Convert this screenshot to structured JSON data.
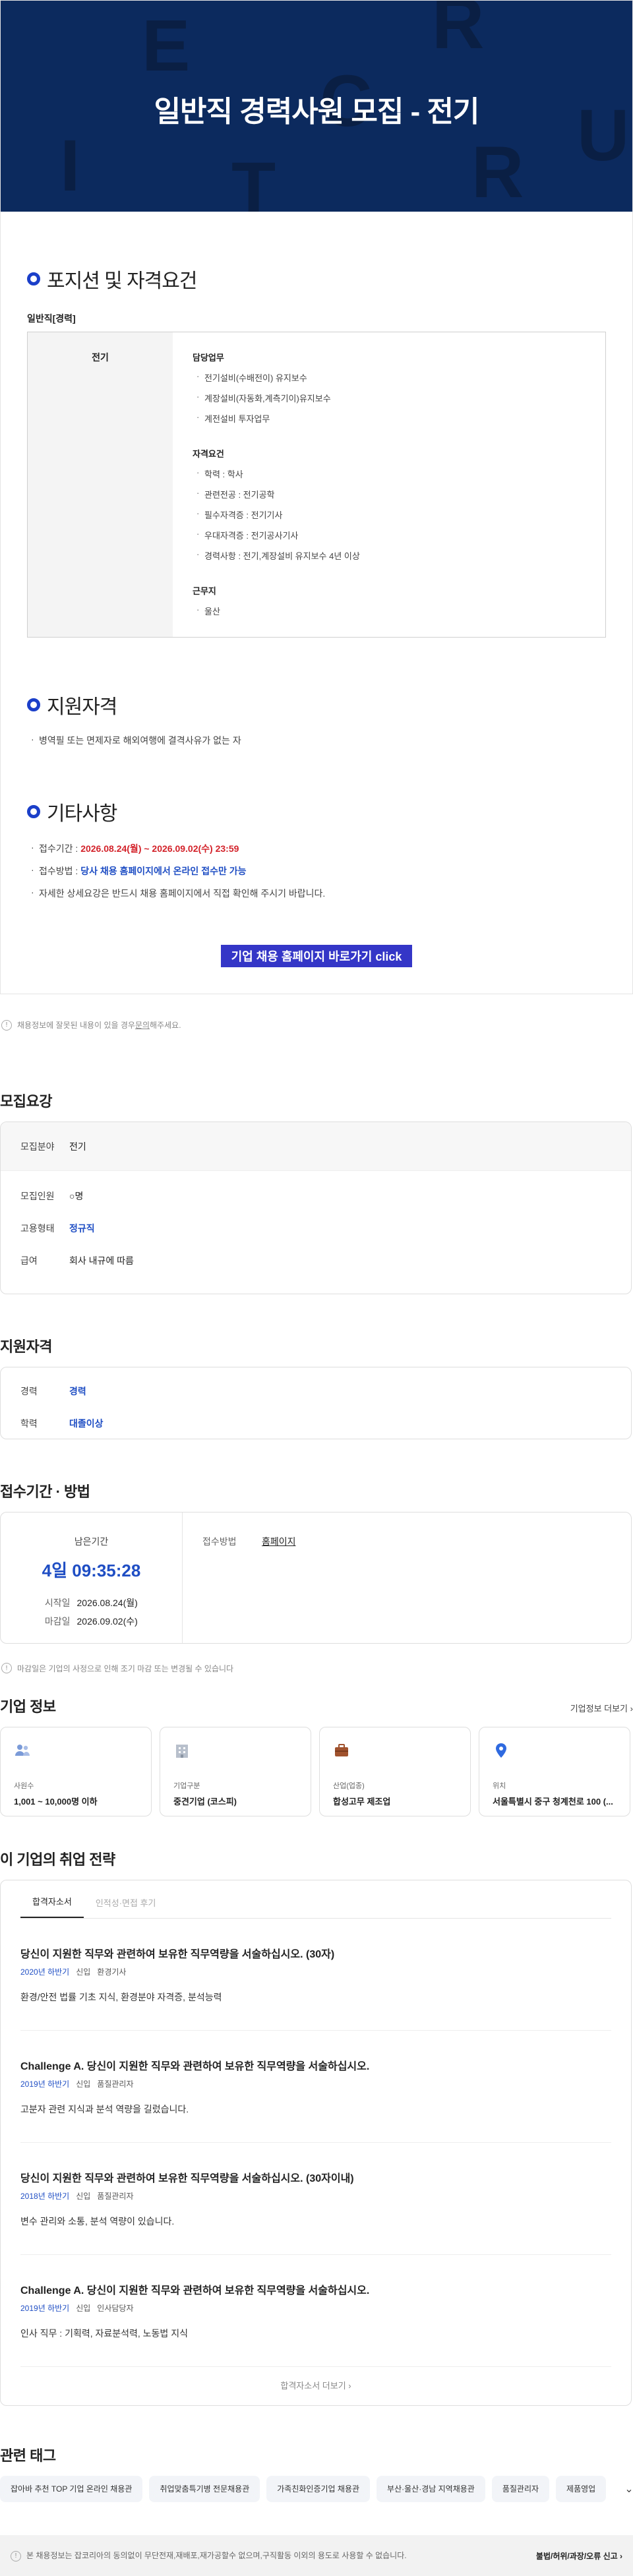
{
  "poster": {
    "banner_title": "일반직 경력사원 모집 - 전기",
    "deco_letters": [
      "E",
      "R",
      "C",
      "U",
      "I",
      "T",
      "R"
    ],
    "section1_title": "포지션 및 자격요건",
    "position_label": "일반직[경력]",
    "field": "전기",
    "groups": [
      {
        "title": "담당업무",
        "items": [
          "전기설비(수배전이) 유지보수",
          "계장설비(자동화,계측기이)유지보수",
          "계전설비 투자업무"
        ]
      },
      {
        "title": "자격요건",
        "items": [
          "학력 : 학사",
          "관련전공 : 전기공학",
          "필수자격증 : 전기기사",
          "우대자격증 : 전기공사기사",
          "경력사항 : 전기,계장설비 유지보수 4년 이상"
        ]
      },
      {
        "title": "근무지",
        "items": [
          "울산"
        ]
      }
    ],
    "section2_title": "지원자격",
    "qualification_text": "병역필 또는 면제자로 해외여행에 결격사유가 없는 자",
    "section3_title": "기타사항",
    "period_label": "접수기간 : ",
    "period_value": "2026.08.24(월) ~ 2026.09.02(수) 23:59",
    "method_label": "접수방법 : ",
    "method_value": "당사 채용 홈페이지에서 온라인 접수만 가능",
    "detail_text": "자세한 상세요강은 반드시 채용 홈페이지에서 직접 확인해 주시기 바랍니다.",
    "cta_label": "기업 채용 홈페이지 바로가기 click"
  },
  "notice": {
    "prefix": "채용정보에 잘못된 내용이 있을 경우 ",
    "link": "문의",
    "suffix": "해주세요."
  },
  "recruit": {
    "title": "모집요강",
    "rows": [
      {
        "k": "모집분야",
        "v": "전기"
      },
      {
        "k": "모집인원",
        "v": "○명"
      },
      {
        "k": "고용형태",
        "v": "정규직"
      },
      {
        "k": "급여",
        "v": "회사 내규에 따름"
      }
    ]
  },
  "qualify": {
    "title": "지원자격",
    "rows": [
      {
        "k": "경력",
        "v": "경력"
      },
      {
        "k": "학력",
        "v": "대졸이상"
      }
    ]
  },
  "due": {
    "title": "접수기간 · 방법",
    "remain_label": "남은기간",
    "remain_time": "4일 09:35:28",
    "start_label": "시작일",
    "start_value": "2026.08.24(월)",
    "end_label": "마감일",
    "end_value": "2026.09.02(수)",
    "method_label": "접수방법",
    "method_value": "홈페이지",
    "notice": "마감일은 기업의 사정으로 인해 조기 마감 또는 변경될 수 있습니다"
  },
  "corp": {
    "title": "기업 정보",
    "more": "기업정보 더보기",
    "cards": [
      {
        "label": "사원수",
        "value": "1,001 ~ 10,000명 이하",
        "icon": "people-icon"
      },
      {
        "label": "기업구분",
        "value": "중견기업 (코스피)",
        "icon": "building-icon"
      },
      {
        "label": "산업(업종)",
        "value": "합성고무 제조업",
        "icon": "briefcase-icon"
      },
      {
        "label": "위치",
        "value": "서울특별시 중구 청계천로 100 (...",
        "icon": "location-pin-icon"
      }
    ]
  },
  "strategy": {
    "title": "이 기업의 취업 전략",
    "tabs": [
      "합격자소서",
      "인적성·면접 후기"
    ],
    "items": [
      {
        "q": "당신이 지원한 직무와 관련하여 보유한 직무역량을 서술하십시오. (30자)",
        "year": "2020년 하반기",
        "type": "신입",
        "job": "환경기사",
        "a": "환경/안전 법률 기초 지식, 환경분야 자격증, 분석능력"
      },
      {
        "q": "Challenge A. 당신이 지원한 직무와 관련하여 보유한 직무역량을 서술하십시오.",
        "year": "2019년 하반기",
        "type": "신입",
        "job": "품질관리자",
        "a": "고분자 관련 지식과 분석 역량을 길렀습니다."
      },
      {
        "q": "당신이 지원한 직무와 관련하여 보유한 직무역량을 서술하십시오. (30자이내)",
        "year": "2018년 하반기",
        "type": "신입",
        "job": "품질관리자",
        "a": "변수 관리와 소통, 분석 역량이 있습니다."
      },
      {
        "q": "Challenge A. 당신이 지원한 직무와 관련하여 보유한 직무역량을 서술하십시오.",
        "year": "2019년 하반기",
        "type": "신입",
        "job": "인사담당자",
        "a": "인사 직무 : 기획력, 자료분석력, 노동법 지식"
      }
    ],
    "more": "합격자소서 더보기"
  },
  "tags": {
    "title": "관련 태그",
    "items": [
      "잡아바 추천 TOP 기업 온라인 채용관",
      "취업맞춤특기병 전문채용관",
      "가족친화인증기업 채용관",
      "부산·울산·경남 지역채용관",
      "품질관리자",
      "제품영업"
    ]
  },
  "footer": {
    "left": "본 채용정보는 잡코리아의 동의없이 무단전재,재배포,재가공할수 없으며,구직활동 이외의 용도로 사용할 수 없습니다.",
    "right": "불법/허위/과장/오류 신고"
  }
}
